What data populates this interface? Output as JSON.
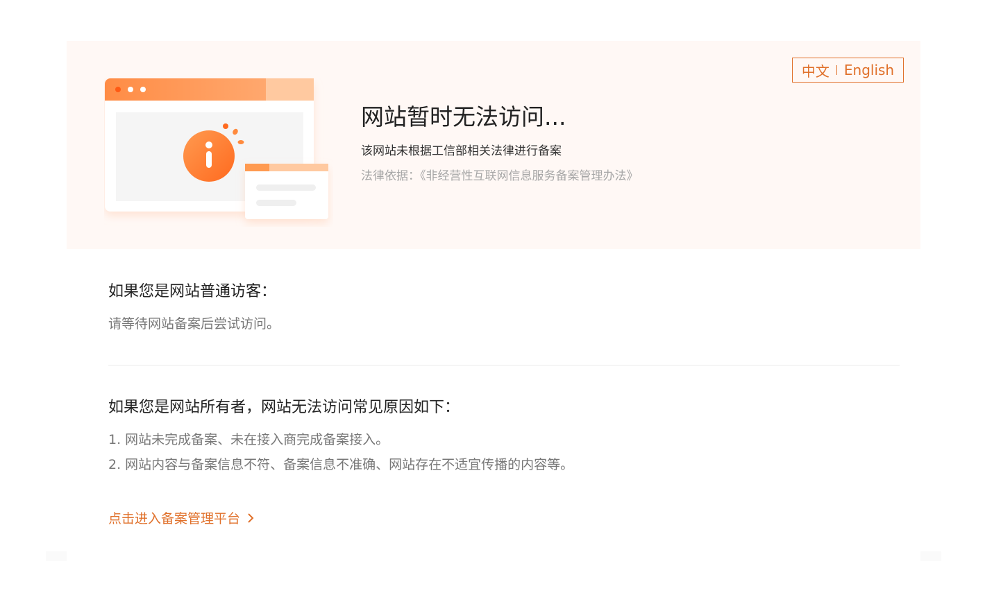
{
  "language_switch": {
    "chinese_label": "中文",
    "english_label": "English"
  },
  "banner": {
    "headline": "网站暂时无法访问...",
    "subline": "该网站未根据工信部相关法律进行备案",
    "law_basis": "法律依据：《非经营性互联网信息服务备案管理办法》",
    "illustration_icon": "info-icon"
  },
  "visitor_section": {
    "title": "如果您是网站普通访客：",
    "text": "请等待网站备案后尝试访问。"
  },
  "owner_section": {
    "title": "如果您是网站所有者，网站无法访问常见原因如下：",
    "reasons": [
      "1. 网站未完成备案、未在接入商完成备案接入。",
      "2. 网站内容与备案信息不符、备案信息不准确、网站存在不适宜传播的内容等。"
    ]
  },
  "platform_link": {
    "label": "点击进入备案管理平台",
    "icon": "chevron-right-icon"
  },
  "colors": {
    "accent": "#e0702a",
    "banner_bg": "#fff8f5",
    "illustration_orange": "#ff8a3d"
  }
}
